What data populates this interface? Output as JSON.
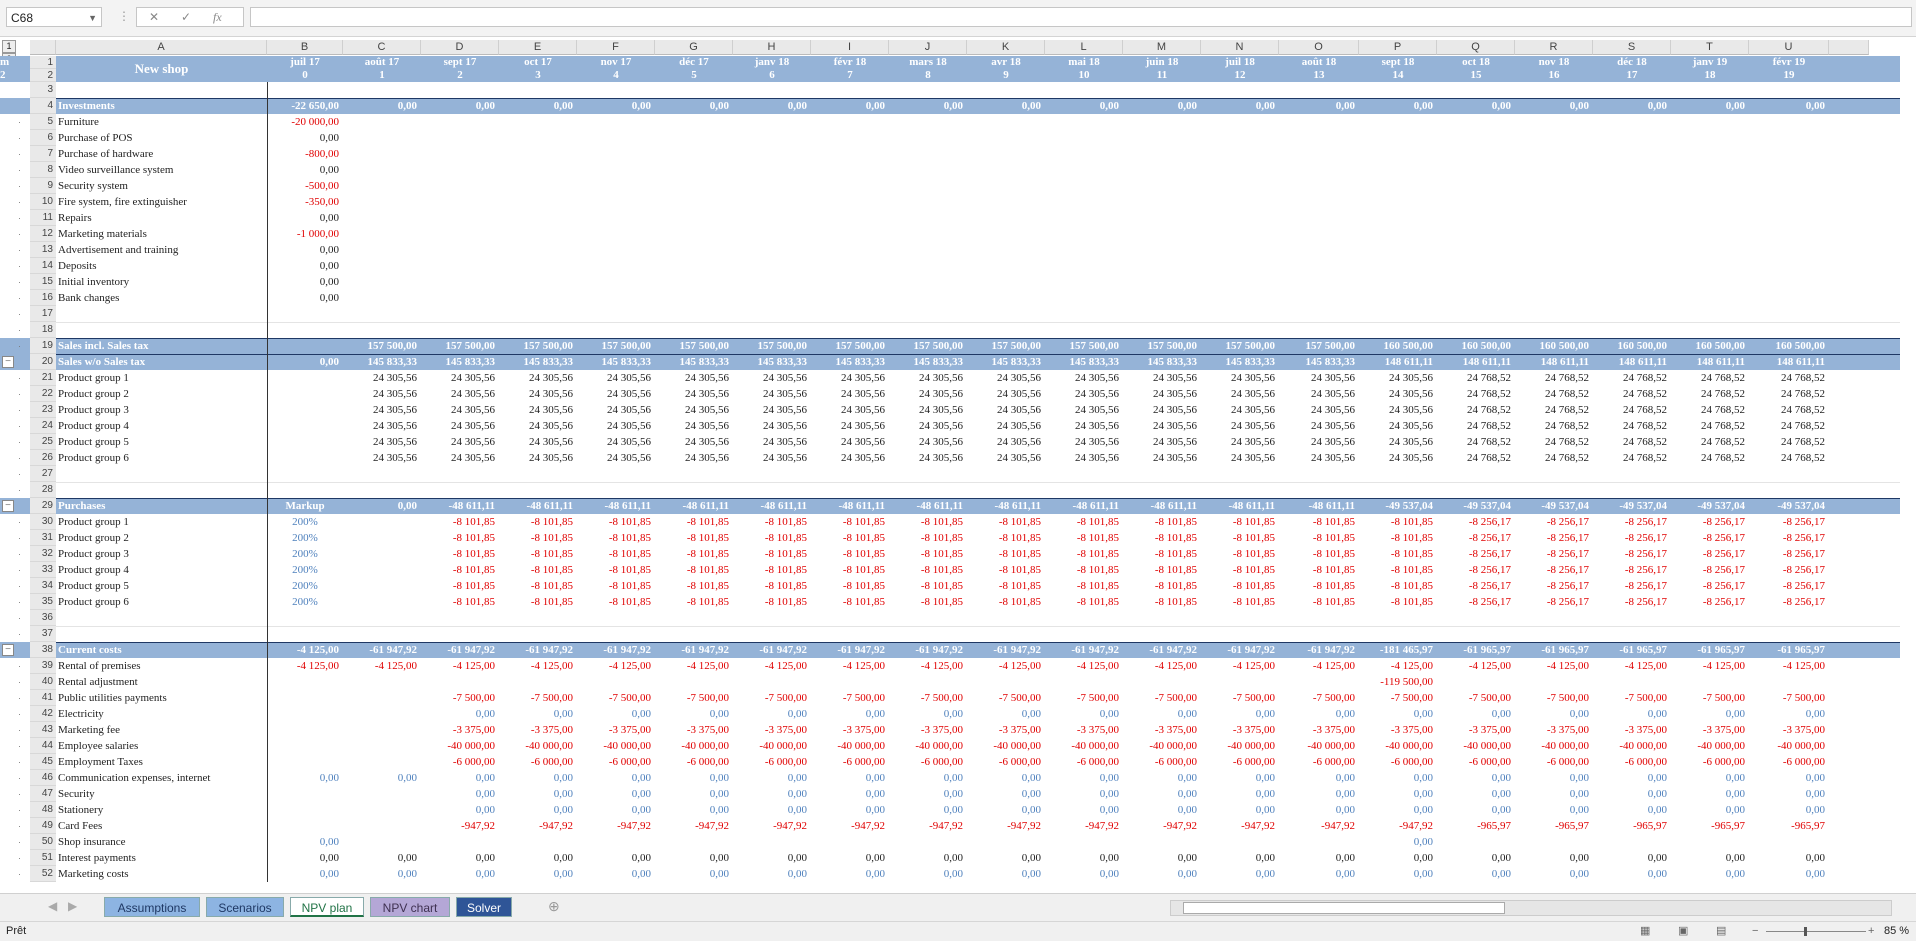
{
  "formula_bar": {
    "name_box": "C68",
    "formula": ""
  },
  "outline_levels": [
    "1",
    "2"
  ],
  "columns": [
    "A",
    "B",
    "C",
    "D",
    "E",
    "F",
    "G",
    "H",
    "I",
    "J",
    "K",
    "L",
    "M",
    "N",
    "O",
    "P",
    "Q",
    "R",
    "S",
    "T",
    "U"
  ],
  "header": {
    "title": "New shop",
    "months": [
      "juil 17",
      "août 17",
      "sept 17",
      "oct 17",
      "nov 17",
      "déc 17",
      "janv 18",
      "févr 18",
      "mars 18",
      "avr 18",
      "mai 18",
      "juin 18",
      "juil 18",
      "août 18",
      "sept 18",
      "oct 18",
      "nov 18",
      "déc 18",
      "janv 19",
      "févr 19",
      "m"
    ],
    "periods": [
      "0",
      "1",
      "2",
      "3",
      "4",
      "5",
      "6",
      "7",
      "8",
      "9",
      "10",
      "11",
      "12",
      "13",
      "14",
      "15",
      "16",
      "17",
      "18",
      "19",
      "2"
    ]
  },
  "rows": [
    {
      "n": "3",
      "type": "blank"
    },
    {
      "n": "4",
      "type": "section",
      "label": "Investments",
      "b": "-22 650,00",
      "bneg": true,
      "v": "0,00",
      "vneg": false
    },
    {
      "n": "5",
      "label": "Furniture",
      "b": "-20 000,00",
      "bc": "neg"
    },
    {
      "n": "6",
      "label": "Purchase of POS",
      "b": "0,00",
      "bc": "blk"
    },
    {
      "n": "7",
      "label": "Purchase of hardware",
      "b": "-800,00",
      "bc": "neg"
    },
    {
      "n": "8",
      "label": "Video surveillance system",
      "b": "0,00",
      "bc": "blk"
    },
    {
      "n": "9",
      "label": "Security system",
      "b": "-500,00",
      "bc": "neg"
    },
    {
      "n": "10",
      "label": "Fire system, fire extinguisher",
      "b": "-350,00",
      "bc": "neg"
    },
    {
      "n": "11",
      "label": "Repairs",
      "b": "0,00",
      "bc": "blk"
    },
    {
      "n": "12",
      "label": "Marketing materials",
      "b": "-1 000,00",
      "bc": "neg"
    },
    {
      "n": "13",
      "label": "Advertisement and training",
      "b": "0,00",
      "bc": "blk"
    },
    {
      "n": "14",
      "label": "Deposits",
      "b": "0,00",
      "bc": "blk"
    },
    {
      "n": "15",
      "label": "Initial inventory",
      "b": "0,00",
      "bc": "blk"
    },
    {
      "n": "16",
      "label": "Bank changes",
      "b": "0,00",
      "bc": "blk"
    },
    {
      "n": "17",
      "type": "blank"
    },
    {
      "n": "18",
      "type": "blank"
    },
    {
      "n": "19",
      "type": "section",
      "label": "Sales incl. Sales tax",
      "b": "",
      "v1": "157 500,00",
      "v2": "160 500,00"
    },
    {
      "n": "20",
      "type": "section",
      "label": "Sales w/o Sales tax",
      "b": "0,00",
      "v1": "145 833,33",
      "v2": "148 611,11"
    },
    {
      "n": "21",
      "label": "Product group 1",
      "v1": "24 305,56",
      "v2": "24 768,52",
      "vc": "blk"
    },
    {
      "n": "22",
      "label": "Product group 2",
      "v1": "24 305,56",
      "v2": "24 768,52",
      "vc": "blk"
    },
    {
      "n": "23",
      "label": "Product group 3",
      "v1": "24 305,56",
      "v2": "24 768,52",
      "vc": "blk"
    },
    {
      "n": "24",
      "label": "Product group 4",
      "v1": "24 305,56",
      "v2": "24 768,52",
      "vc": "blk"
    },
    {
      "n": "25",
      "label": "Product group 5",
      "v1": "24 305,56",
      "v2": "24 768,52",
      "vc": "blk"
    },
    {
      "n": "26",
      "label": "Product group 6",
      "v1": "24 305,56",
      "v2": "24 768,52",
      "vc": "blk"
    },
    {
      "n": "27",
      "type": "blank"
    },
    {
      "n": "28",
      "type": "blank"
    },
    {
      "n": "29",
      "type": "section",
      "label": "Purchases",
      "b": "Markup",
      "c": "0,00",
      "v1": "-48 611,11",
      "v2": "-49 537,04"
    },
    {
      "n": "30",
      "label": "Product group 1",
      "b": "200%",
      "v1": "-8 101,85",
      "v2": "-8 256,17",
      "vc": "neg"
    },
    {
      "n": "31",
      "label": "Product group 2",
      "b": "200%",
      "v1": "-8 101,85",
      "v2": "-8 256,17",
      "vc": "neg"
    },
    {
      "n": "32",
      "label": "Product group 3",
      "b": "200%",
      "v1": "-8 101,85",
      "v2": "-8 256,17",
      "vc": "neg"
    },
    {
      "n": "33",
      "label": "Product group 4",
      "b": "200%",
      "v1": "-8 101,85",
      "v2": "-8 256,17",
      "vc": "neg"
    },
    {
      "n": "34",
      "label": "Product group 5",
      "b": "200%",
      "v1": "-8 101,85",
      "v2": "-8 256,17",
      "vc": "neg"
    },
    {
      "n": "35",
      "label": "Product group 6",
      "b": "200%",
      "v1": "-8 101,85",
      "v2": "-8 256,17",
      "vc": "neg"
    },
    {
      "n": "36",
      "type": "blank"
    },
    {
      "n": "37",
      "type": "blank"
    },
    {
      "n": "38",
      "type": "section",
      "label": "Current costs",
      "b": "-4 125,00",
      "v1": "-61 947,92",
      "o": "-181 465,97",
      "v2": "-61 965,97"
    },
    {
      "n": "39",
      "label": "Rental of premises",
      "b": "-4 125,00",
      "v1": "-4 125,00",
      "v2": "-4 125,00",
      "vc": "neg",
      "bc": "neg"
    },
    {
      "n": "40",
      "label": "Rental adjustment",
      "o": "-119 500,00",
      "oc": "neg"
    },
    {
      "n": "41",
      "label": "Public utilities payments",
      "v1": "-7 500,00",
      "v2": "-7 500,00",
      "vc": "neg"
    },
    {
      "n": "42",
      "label": "Electricity",
      "v1": "0,00",
      "v2": "0,00",
      "vc": "blue"
    },
    {
      "n": "43",
      "label": "Marketing fee",
      "v1": "-3 375,00",
      "v2": "-3 375,00",
      "vc": "neg"
    },
    {
      "n": "44",
      "label": "Employee salaries",
      "v1": "-40 000,00",
      "v2": "-40 000,00",
      "vc": "neg"
    },
    {
      "n": "45",
      "label": "Employment Taxes",
      "v1": "-6 000,00",
      "v2": "-6 000,00",
      "vc": "neg"
    },
    {
      "n": "46",
      "label": "Communication expenses, internet",
      "b": "0,00",
      "bc": "blue",
      "v1": "0,00",
      "v2": "0,00",
      "vc": "blue"
    },
    {
      "n": "47",
      "label": "Security",
      "v1": "0,00",
      "v2": "0,00",
      "vc": "blue"
    },
    {
      "n": "48",
      "label": "Stationery",
      "v1": "0,00",
      "v2": "0,00",
      "vc": "blue"
    },
    {
      "n": "49",
      "label": "Card Fees",
      "v1": "-947,92",
      "v2": "-965,97",
      "vc": "neg"
    },
    {
      "n": "50",
      "label": "Shop insurance",
      "b": "0,00",
      "bc": "blue",
      "n13": "0,00"
    },
    {
      "n": "51",
      "label": "Interest payments",
      "b": "0,00",
      "bc": "blk",
      "v1": "0,00",
      "v2": "0,00",
      "vc": "blk"
    },
    {
      "n": "52",
      "label": "Marketing costs",
      "b": "0,00",
      "bc": "blue",
      "v1": "0,00",
      "v2": "0,00",
      "vc": "blue"
    }
  ],
  "sheet_tabs": [
    {
      "label": "Assumptions",
      "bg": "#8db4e2",
      "fg": "#1f3864"
    },
    {
      "label": "Scenarios",
      "bg": "#8db4e2",
      "fg": "#1f3864"
    },
    {
      "label": "NPV plan",
      "bg": "#ffffff",
      "fg": "#217346"
    },
    {
      "label": "NPV chart",
      "bg": "#b4a7d6",
      "fg": "#3f3151"
    },
    {
      "label": "Solver",
      "bg": "#2f5597",
      "fg": "#ffffff"
    }
  ],
  "status": {
    "mode": "Prêt",
    "zoom": "85 %"
  },
  "colors": {
    "header_blue": "#95b3d7",
    "negative": "#e00000",
    "input_blue": "#4f81bd"
  }
}
